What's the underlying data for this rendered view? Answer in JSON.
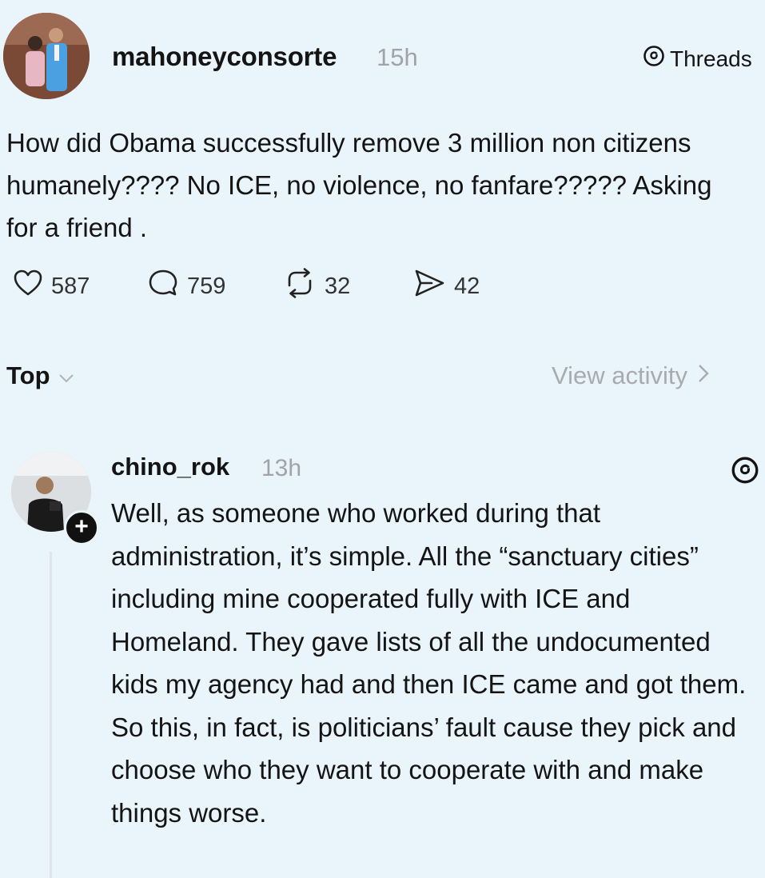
{
  "post": {
    "username": "mahoneyconsorte",
    "time": "15h",
    "platform_label": "Threads",
    "text": "How did Obama successfully remove 3 million non citizens humanely???? No ICE, no violence, no fanfare????? Asking for a friend .",
    "stats": {
      "likes": "587",
      "replies": "759",
      "reposts": "32",
      "shares": "42"
    }
  },
  "replies_header": {
    "sort_label": "Top",
    "view_activity_label": "View activity"
  },
  "reply": {
    "username": "chino_rok",
    "time": "13h",
    "follow_symbol": "+",
    "text": "Well, as someone who worked during that administration, it’s simple. All the “sanctuary cities” including mine cooperated fully with ICE and Homeland. They gave lists of all the undocumented kids my agency had and then ICE came and got them. So this, in fact, is politicians’ fault cause they pick and choose who they want to cooperate with and make things worse."
  },
  "icons": {
    "like": "heart-icon",
    "reply": "speech-bubble-icon",
    "repost": "repost-icon",
    "share": "send-icon",
    "platform": "threads-logo-icon"
  },
  "colors": {
    "background": "#eaf4fb",
    "text": "#141414",
    "muted": "#a0a4a8"
  }
}
